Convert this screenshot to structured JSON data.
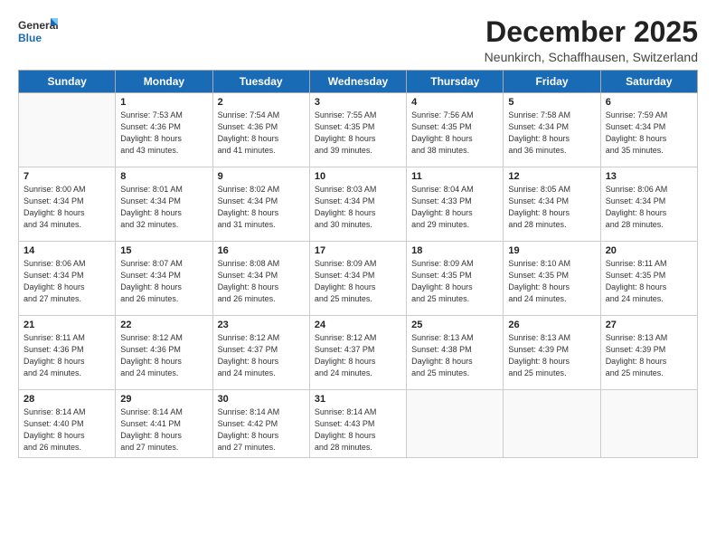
{
  "logo": {
    "general": "General",
    "blue": "Blue"
  },
  "title": "December 2025",
  "subtitle": "Neunkirch, Schaffhausen, Switzerland",
  "headers": [
    "Sunday",
    "Monday",
    "Tuesday",
    "Wednesday",
    "Thursday",
    "Friday",
    "Saturday"
  ],
  "weeks": [
    [
      {
        "day": "",
        "info": ""
      },
      {
        "day": "1",
        "info": "Sunrise: 7:53 AM\nSunset: 4:36 PM\nDaylight: 8 hours\nand 43 minutes."
      },
      {
        "day": "2",
        "info": "Sunrise: 7:54 AM\nSunset: 4:36 PM\nDaylight: 8 hours\nand 41 minutes."
      },
      {
        "day": "3",
        "info": "Sunrise: 7:55 AM\nSunset: 4:35 PM\nDaylight: 8 hours\nand 39 minutes."
      },
      {
        "day": "4",
        "info": "Sunrise: 7:56 AM\nSunset: 4:35 PM\nDaylight: 8 hours\nand 38 minutes."
      },
      {
        "day": "5",
        "info": "Sunrise: 7:58 AM\nSunset: 4:34 PM\nDaylight: 8 hours\nand 36 minutes."
      },
      {
        "day": "6",
        "info": "Sunrise: 7:59 AM\nSunset: 4:34 PM\nDaylight: 8 hours\nand 35 minutes."
      }
    ],
    [
      {
        "day": "7",
        "info": "Sunrise: 8:00 AM\nSunset: 4:34 PM\nDaylight: 8 hours\nand 34 minutes."
      },
      {
        "day": "8",
        "info": "Sunrise: 8:01 AM\nSunset: 4:34 PM\nDaylight: 8 hours\nand 32 minutes."
      },
      {
        "day": "9",
        "info": "Sunrise: 8:02 AM\nSunset: 4:34 PM\nDaylight: 8 hours\nand 31 minutes."
      },
      {
        "day": "10",
        "info": "Sunrise: 8:03 AM\nSunset: 4:34 PM\nDaylight: 8 hours\nand 30 minutes."
      },
      {
        "day": "11",
        "info": "Sunrise: 8:04 AM\nSunset: 4:33 PM\nDaylight: 8 hours\nand 29 minutes."
      },
      {
        "day": "12",
        "info": "Sunrise: 8:05 AM\nSunset: 4:34 PM\nDaylight: 8 hours\nand 28 minutes."
      },
      {
        "day": "13",
        "info": "Sunrise: 8:06 AM\nSunset: 4:34 PM\nDaylight: 8 hours\nand 28 minutes."
      }
    ],
    [
      {
        "day": "14",
        "info": "Sunrise: 8:06 AM\nSunset: 4:34 PM\nDaylight: 8 hours\nand 27 minutes."
      },
      {
        "day": "15",
        "info": "Sunrise: 8:07 AM\nSunset: 4:34 PM\nDaylight: 8 hours\nand 26 minutes."
      },
      {
        "day": "16",
        "info": "Sunrise: 8:08 AM\nSunset: 4:34 PM\nDaylight: 8 hours\nand 26 minutes."
      },
      {
        "day": "17",
        "info": "Sunrise: 8:09 AM\nSunset: 4:34 PM\nDaylight: 8 hours\nand 25 minutes."
      },
      {
        "day": "18",
        "info": "Sunrise: 8:09 AM\nSunset: 4:35 PM\nDaylight: 8 hours\nand 25 minutes."
      },
      {
        "day": "19",
        "info": "Sunrise: 8:10 AM\nSunset: 4:35 PM\nDaylight: 8 hours\nand 24 minutes."
      },
      {
        "day": "20",
        "info": "Sunrise: 8:11 AM\nSunset: 4:35 PM\nDaylight: 8 hours\nand 24 minutes."
      }
    ],
    [
      {
        "day": "21",
        "info": "Sunrise: 8:11 AM\nSunset: 4:36 PM\nDaylight: 8 hours\nand 24 minutes."
      },
      {
        "day": "22",
        "info": "Sunrise: 8:12 AM\nSunset: 4:36 PM\nDaylight: 8 hours\nand 24 minutes."
      },
      {
        "day": "23",
        "info": "Sunrise: 8:12 AM\nSunset: 4:37 PM\nDaylight: 8 hours\nand 24 minutes."
      },
      {
        "day": "24",
        "info": "Sunrise: 8:12 AM\nSunset: 4:37 PM\nDaylight: 8 hours\nand 24 minutes."
      },
      {
        "day": "25",
        "info": "Sunrise: 8:13 AM\nSunset: 4:38 PM\nDaylight: 8 hours\nand 25 minutes."
      },
      {
        "day": "26",
        "info": "Sunrise: 8:13 AM\nSunset: 4:39 PM\nDaylight: 8 hours\nand 25 minutes."
      },
      {
        "day": "27",
        "info": "Sunrise: 8:13 AM\nSunset: 4:39 PM\nDaylight: 8 hours\nand 25 minutes."
      }
    ],
    [
      {
        "day": "28",
        "info": "Sunrise: 8:14 AM\nSunset: 4:40 PM\nDaylight: 8 hours\nand 26 minutes."
      },
      {
        "day": "29",
        "info": "Sunrise: 8:14 AM\nSunset: 4:41 PM\nDaylight: 8 hours\nand 27 minutes."
      },
      {
        "day": "30",
        "info": "Sunrise: 8:14 AM\nSunset: 4:42 PM\nDaylight: 8 hours\nand 27 minutes."
      },
      {
        "day": "31",
        "info": "Sunrise: 8:14 AM\nSunset: 4:43 PM\nDaylight: 8 hours\nand 28 minutes."
      },
      {
        "day": "",
        "info": ""
      },
      {
        "day": "",
        "info": ""
      },
      {
        "day": "",
        "info": ""
      }
    ]
  ]
}
